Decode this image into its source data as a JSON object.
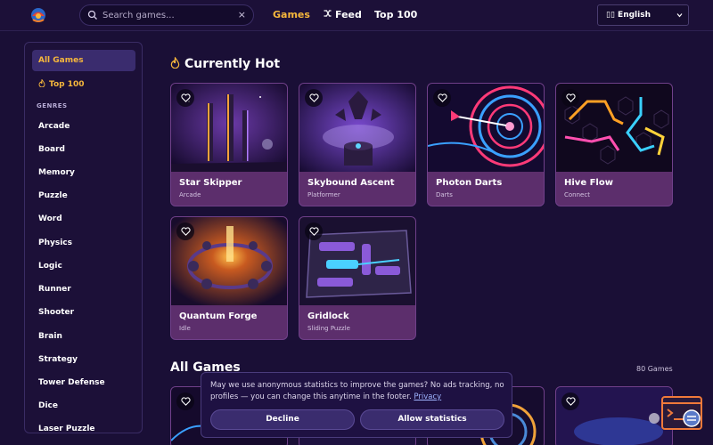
{
  "header": {
    "search_placeholder": "Search games...",
    "clear_glyph": "×",
    "nav": {
      "games": "Games",
      "feed": "Feed",
      "top100": "Top 100"
    },
    "language": "English",
    "language_flag_glyph": "▯▯"
  },
  "sidebar": {
    "all_games": "All Games",
    "top100": "Top 100",
    "genres_heading": "GENRES",
    "genres": [
      "Arcade",
      "Board",
      "Memory",
      "Puzzle",
      "Word",
      "Physics",
      "Logic",
      "Runner",
      "Shooter",
      "Brain",
      "Strategy",
      "Tower Defense",
      "Dice",
      "Laser Puzzle"
    ]
  },
  "hot": {
    "title": "Currently Hot",
    "games": [
      {
        "title": "Star Skipper",
        "genre": "Arcade"
      },
      {
        "title": "Skybound Ascent",
        "genre": "Platformer"
      },
      {
        "title": "Photon Darts",
        "genre": "Darts"
      },
      {
        "title": "Hive Flow",
        "genre": "Connect"
      },
      {
        "title": "Quantum Forge",
        "genre": "Idle"
      },
      {
        "title": "Gridlock",
        "genre": "Sliding Puzzle"
      }
    ]
  },
  "all_games": {
    "title": "All Games",
    "count": "80 Games"
  },
  "cookie": {
    "message": "May we use anonymous statistics to improve the games? No ads tracking, no profiles — you can change this anytime in the footer.",
    "privacy_link": "Privacy",
    "decline": "Decline",
    "allow": "Allow statistics"
  },
  "colors": {
    "accent": "#f6b73c",
    "background": "#1a0f36",
    "card": "#5c2e6c"
  },
  "icons": [
    "logo-icon",
    "search-icon",
    "close-icon",
    "shuffle-icon",
    "chevron-down-icon",
    "flame-icon",
    "heart-icon",
    "feedback-icon"
  ]
}
